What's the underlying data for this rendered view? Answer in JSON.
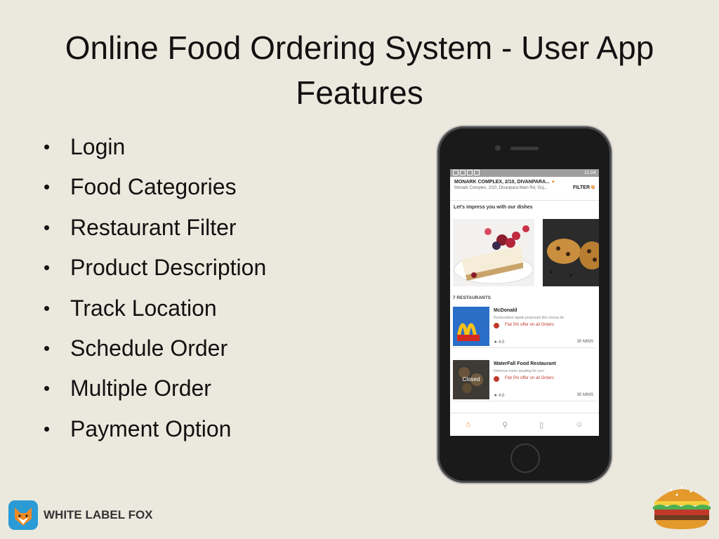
{
  "slide": {
    "title": "Online Food Ordering System - User App Features",
    "features": [
      "Login",
      "Food Categories",
      "Restaurant Filter",
      "Product Description",
      "Track Location",
      "Schedule Order",
      "Multiple Order",
      "Payment Option"
    ],
    "bullet": "•"
  },
  "phone": {
    "status": {
      "time": "11:04"
    },
    "address": {
      "title": "MONARK COMPLEX, 2/10, DIVANPARA...",
      "subtitle": "Monark Complex, 2/10, Divanpara Main Rd, Guj...",
      "filter_label": "FILTER"
    },
    "impress_label": "Let's impress you with our dishes",
    "restaurants_label": "7 RESTAURANTS",
    "restaurants": [
      {
        "name": "McDonald",
        "desc": "Restauration rapide proposant des menus de",
        "offer": "Flat 5% offer on all Orders",
        "rating": "★ 4.0",
        "time": "30 MINS",
        "closed": ""
      },
      {
        "name": "WaterFall Food Restaurant",
        "desc": "Delicious menu awaiting for you!",
        "offer": "Flat 5% offer on all Orders",
        "rating": "★ 4.0",
        "time": "30 MINS",
        "closed": "Closed"
      }
    ],
    "tabs": [
      "home-icon",
      "search-icon",
      "orders-icon",
      "profile-icon"
    ]
  },
  "brand": {
    "name": "WHITE LABEL FOX"
  },
  "colors": {
    "background": "#ebe8dd",
    "accent": "#e67e22",
    "offer": "#c0392b",
    "brand_blue": "#2b9bd6"
  }
}
